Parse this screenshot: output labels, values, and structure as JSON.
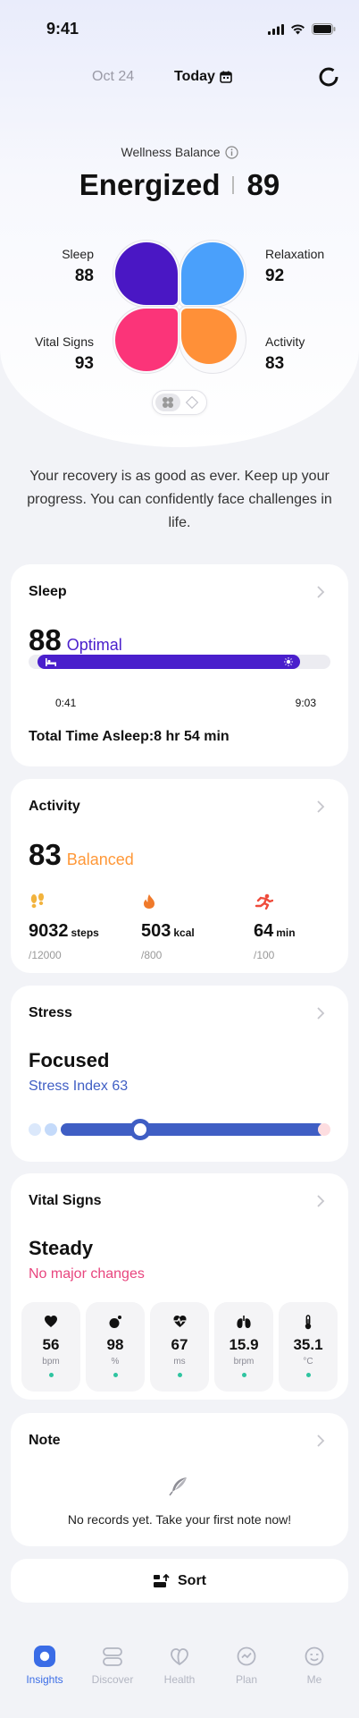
{
  "status_bar": {
    "time": "9:41"
  },
  "nav": {
    "prev_date": "Oct 24",
    "today": "Today"
  },
  "wellness": {
    "label": "Wellness Balance",
    "state": "Energized",
    "score": "89",
    "metrics": {
      "sleep": {
        "label": "Sleep",
        "value": "88"
      },
      "relaxation": {
        "label": "Relaxation",
        "value": "92"
      },
      "vital_signs": {
        "label": "Vital Signs",
        "value": "93"
      },
      "activity": {
        "label": "Activity",
        "value": "83"
      }
    },
    "colors": {
      "sleep": "#4a17c4",
      "relaxation": "#4aa0fb",
      "vital_signs": "#fb3479",
      "activity": "#ff9038"
    }
  },
  "summary": "Your recovery is as good as ever. Keep up your progress. You can confidently face challenges in life.",
  "sleep_card": {
    "title": "Sleep",
    "score": "88",
    "status": "Optimal",
    "start": "0:41",
    "end": "9:03",
    "total": "Total Time Asleep:8 hr 54 min",
    "color": "#4a1fcc"
  },
  "activity_card": {
    "title": "Activity",
    "score": "83",
    "status": "Balanced",
    "status_color": "#ff9838",
    "items": [
      {
        "icon": "footsteps-icon",
        "value": "9032",
        "unit": "steps",
        "goal": "/12000"
      },
      {
        "icon": "flame-icon",
        "value": "503",
        "unit": "kcal",
        "goal": "/800"
      },
      {
        "icon": "running-icon",
        "value": "64",
        "unit": "min",
        "goal": "/100"
      }
    ]
  },
  "stress_card": {
    "title": "Stress",
    "state": "Focused",
    "index_text": "Stress Index 63",
    "level": 0.3,
    "color": "#3f5ec4"
  },
  "vital_card": {
    "title": "Vital Signs",
    "state": "Steady",
    "status": "No major changes",
    "status_color": "#e8457e",
    "items": [
      {
        "icon": "heart-icon",
        "value": "56",
        "unit": "bpm"
      },
      {
        "icon": "oxygen-icon",
        "value": "98",
        "unit": "%"
      },
      {
        "icon": "hrv-icon",
        "value": "67",
        "unit": "ms"
      },
      {
        "icon": "lungs-icon",
        "value": "15.9",
        "unit": "brpm"
      },
      {
        "icon": "thermometer-icon",
        "value": "35.1",
        "unit": "°C"
      }
    ]
  },
  "note_card": {
    "title": "Note",
    "empty_text": "No records yet. Take your first note now!"
  },
  "sort_button": {
    "label": "Sort"
  },
  "tabs": [
    {
      "label": "Insights",
      "icon": "insights-icon",
      "active": true
    },
    {
      "label": "Discover",
      "icon": "discover-icon",
      "active": false
    },
    {
      "label": "Health",
      "icon": "health-icon",
      "active": false
    },
    {
      "label": "Plan",
      "icon": "plan-icon",
      "active": false
    },
    {
      "label": "Me",
      "icon": "me-icon",
      "active": false
    }
  ]
}
